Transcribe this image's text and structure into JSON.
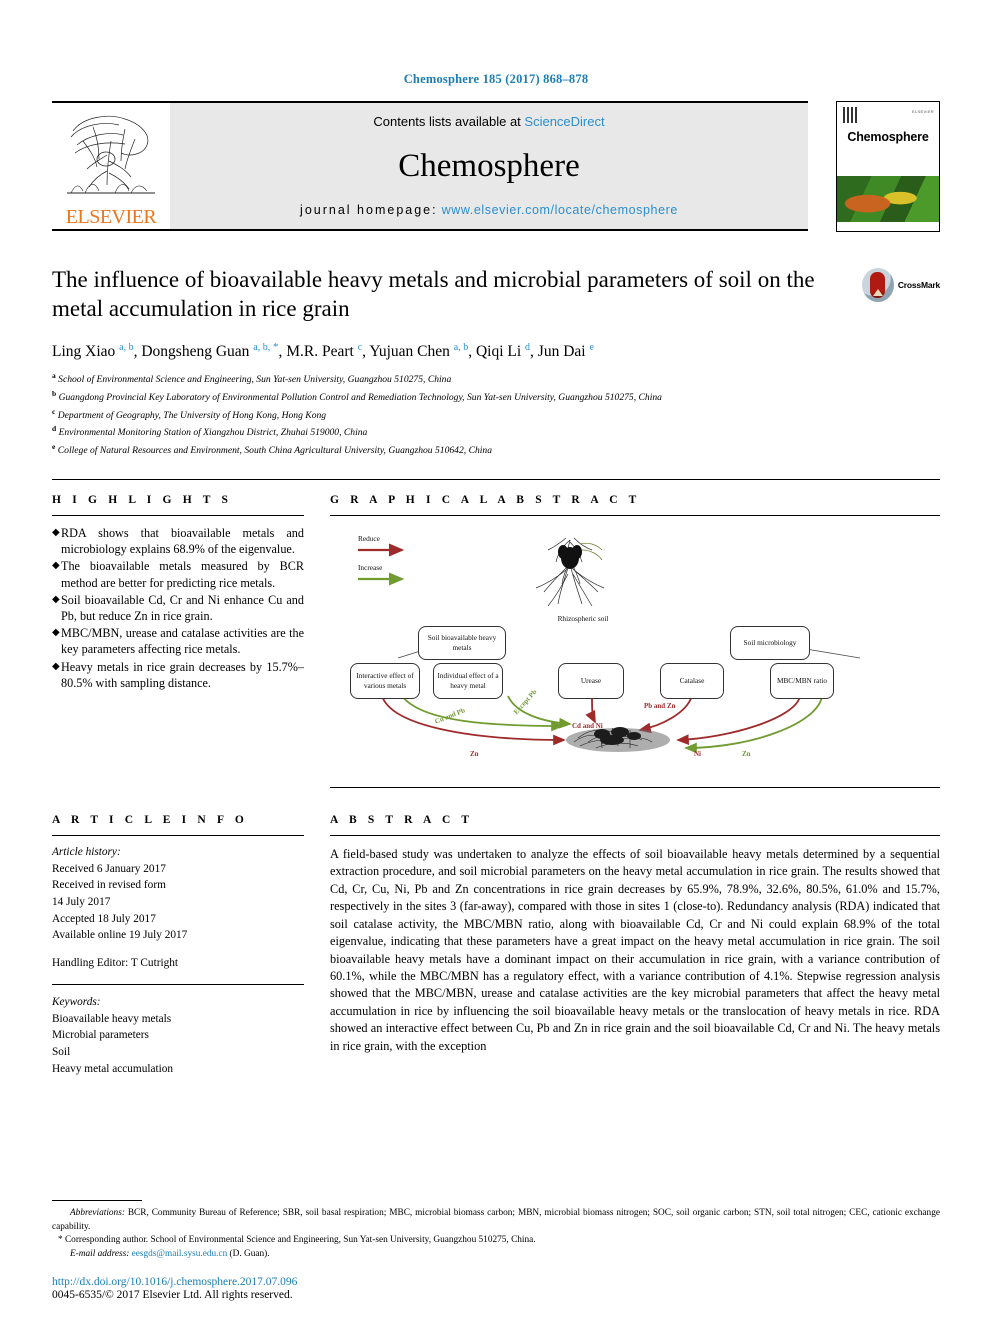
{
  "running_head": "Chemosphere 185 (2017) 868–878",
  "banner": {
    "contents_prefix": "Contents lists available at ",
    "contents_link": "ScienceDirect",
    "journal_name": "Chemosphere",
    "homepage_label": "journal homepage:",
    "homepage_url": "www.elsevier.com/locate/chemosphere",
    "publisher": "ELSEVIER",
    "cover_title": "Chemosphere",
    "cover_tiny": "ELSEVIER"
  },
  "article": {
    "title": "The influence of bioavailable heavy metals and microbial parameters of soil on the metal accumulation in rice grain",
    "crossmark_label": "CrossMark",
    "authors": [
      {
        "name": "Ling Xiao",
        "marks": "a, b",
        "star": false,
        "sep": ", "
      },
      {
        "name": "Dongsheng Guan",
        "marks": "a, b,",
        "star": true,
        "sep": ", "
      },
      {
        "name": "M.R. Peart",
        "marks": "c",
        "star": false,
        "sep": ", "
      },
      {
        "name": "Yujuan Chen",
        "marks": "a, b",
        "star": false,
        "sep": ", "
      },
      {
        "name": "Qiqi Li",
        "marks": "d",
        "star": false,
        "sep": ", "
      },
      {
        "name": "Jun Dai",
        "marks": "e",
        "star": false,
        "sep": ""
      }
    ],
    "affiliations": [
      {
        "mark": "a",
        "text": "School of Environmental Science and Engineering, Sun Yat-sen University, Guangzhou 510275, China"
      },
      {
        "mark": "b",
        "text": "Guangdong Provincial Key Laboratory of Environmental Pollution Control and Remediation Technology, Sun Yat-sen University, Guangzhou 510275, China"
      },
      {
        "mark": "c",
        "text": "Department of Geography, The University of Hong Kong, Hong Kong"
      },
      {
        "mark": "d",
        "text": "Environmental Monitoring Station of Xiangzhou District, Zhuhai 519000, China"
      },
      {
        "mark": "e",
        "text": "College of Natural Resources and Environment, South China Agricultural University, Guangzhou 510642, China"
      }
    ]
  },
  "highlights": {
    "heading": "H I G H L I G H T S",
    "items": [
      "RDA shows that bioavailable metals and microbiology explains 68.9% of the eigenvalue.",
      "The bioavailable metals measured by BCR method are better for predicting rice metals.",
      "Soil bioavailable Cd, Cr and Ni enhance Cu and Pb, but reduce Zn in rice grain.",
      "MBC/MBN, urease and catalase activities are the key parameters affecting rice metals.",
      "Heavy metals in rice grain decreases by 15.7%–80.5% with sampling distance."
    ]
  },
  "graphical_abstract": {
    "heading": "G R A P H I C A L  A B S T R A C T",
    "legend": [
      {
        "label": "Reduce",
        "color": "#9e2a2a"
      },
      {
        "label": "Increase",
        "color": "#6f9b2f"
      }
    ],
    "soil_label": "Rhizospheric soil",
    "tier1": [
      "Soil bioavailable heavy metals",
      "Soil microbiology"
    ],
    "tier2": [
      "Interactive effect of various metals",
      "Individual effect of a heavy metal",
      "Urease",
      "Catalase",
      "MBC/MBN ratio"
    ],
    "arrow_labels": [
      {
        "text": "Cu and Pb",
        "color": "#6f9b2f"
      },
      {
        "text": "Except Pb",
        "color": "#6f9b2f"
      },
      {
        "text": "Zn",
        "color": "#9e2a2a"
      },
      {
        "text": "Cd and Ni",
        "color": "#9e2a2a"
      },
      {
        "text": "Pb and Zn",
        "color": "#9e2a2a"
      },
      {
        "text": "Ni",
        "color": "#9e2a2a"
      },
      {
        "text": "Zn",
        "color": "#6f9b2f"
      }
    ]
  },
  "article_info": {
    "heading": "A R T I C L E  I N F O",
    "history_label": "Article history:",
    "history": [
      "Received 6 January 2017",
      "Received in revised form",
      "14 July 2017",
      "Accepted 18 July 2017",
      "Available online 19 July 2017"
    ],
    "handling_editor": "Handling Editor: T Cutright",
    "keywords_label": "Keywords:",
    "keywords": [
      "Bioavailable heavy metals",
      "Microbial parameters",
      "Soil",
      "Heavy metal accumulation"
    ]
  },
  "abstract": {
    "heading": "A B S T R A C T",
    "text": "A field-based study was undertaken to analyze the effects of soil bioavailable heavy metals determined by a sequential extraction procedure, and soil microbial parameters on the heavy metal accumulation in rice grain. The results showed that Cd, Cr, Cu, Ni, Pb and Zn concentrations in rice grain decreases by 65.9%, 78.9%, 32.6%, 80.5%, 61.0% and 15.7%, respectively in the sites 3 (far-away), compared with those in sites 1 (close-to). Redundancy analysis (RDA) indicated that soil catalase activity, the MBC/MBN ratio, along with bioavailable Cd, Cr and Ni could explain 68.9% of the total eigenvalue, indicating that these parameters have a great impact on the heavy metal accumulation in rice grain. The soil bioavailable heavy metals have a dominant impact on their accumulation in rice grain, with a variance contribution of 60.1%, while the MBC/MBN has a regulatory effect, with a variance contribution of 4.1%. Stepwise regression analysis showed that the MBC/MBN, urease and catalase activities are the key microbial parameters that affect the heavy metal accumulation in rice by influencing the soil bioavailable heavy metals or the translocation of heavy metals in rice. RDA showed an interactive effect between Cu, Pb and Zn in rice grain and the soil bioavailable Cd, Cr and Ni. The heavy metals in rice grain, with the exception"
  },
  "footer": {
    "abbrev_label": "Abbreviations:",
    "abbrev_text": "BCR, Community Bureau of Reference; SBR, soil basal respiration; MBC, microbial biomass carbon; MBN, microbial biomass nitrogen; SOC, soil organic carbon; STN, soil total nitrogen; CEC, cationic exchange capability.",
    "corresponding": "Corresponding author. School of Environmental Science and Engineering, Sun Yat-sen University, Guangzhou 510275, China.",
    "email_label": "E-mail address:",
    "email": "eesgds@mail.sysu.edu.cn",
    "email_suffix": "(D. Guan).",
    "doi": "http://dx.doi.org/10.1016/j.chemosphere.2017.07.096",
    "copyright": "0045-6535/© 2017 Elsevier Ltd. All rights reserved."
  }
}
